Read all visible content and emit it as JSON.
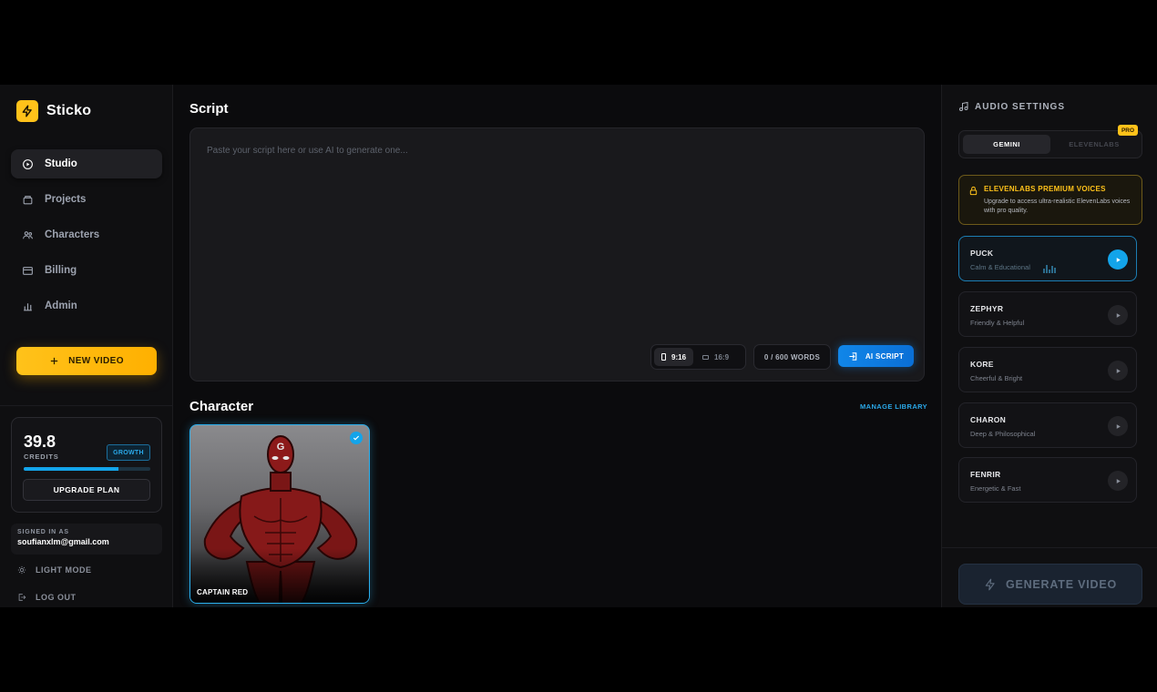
{
  "brand": {
    "name": "Sticko"
  },
  "nav": [
    {
      "label": "Studio",
      "icon": "play-circle-icon",
      "active": true
    },
    {
      "label": "Projects",
      "icon": "folder-icon",
      "active": false
    },
    {
      "label": "Characters",
      "icon": "users-icon",
      "active": false
    },
    {
      "label": "Billing",
      "icon": "credit-card-icon",
      "active": false
    },
    {
      "label": "Admin",
      "icon": "bar-chart-icon",
      "active": false
    }
  ],
  "new_video": {
    "label": "NEW VIDEO"
  },
  "credits": {
    "amount": "39.8",
    "label": "CREDITS",
    "plan": "GROWTH",
    "usage_fraction": 0.75,
    "upgrade_label": "UPGRADE PLAN"
  },
  "account": {
    "signed_in_label": "SIGNED IN AS",
    "email": "soufianxlm@gmail.com",
    "light_mode_label": "LIGHT MODE",
    "logout_label": "LOG OUT"
  },
  "script": {
    "title": "Script",
    "placeholder": "Paste your script here or use AI to generate one...",
    "ratios": [
      {
        "label": "9:16",
        "active": true
      },
      {
        "label": "16:9",
        "active": false
      }
    ],
    "word_count": "0 / 600 WORDS",
    "ai_label": "AI SCRIPT"
  },
  "character": {
    "title": "Character",
    "manage_label": "MANAGE LIBRARY",
    "selected": {
      "name": "CAPTAIN RED",
      "emblem": "G"
    }
  },
  "audio": {
    "title": "AUDIO SETTINGS",
    "providers": [
      {
        "label": "GEMINI",
        "active": true
      },
      {
        "label": "ELEVENLABS",
        "active": false
      }
    ],
    "pro_badge": "PRO",
    "premium": {
      "title": "ELEVENLABS PREMIUM VOICES",
      "desc": "Upgrade to access ultra-realistic ElevenLabs voices with pro quality."
    },
    "voices": [
      {
        "name": "PUCK",
        "desc": "Calm & Educational",
        "active": true
      },
      {
        "name": "ZEPHYR",
        "desc": "Friendly & Helpful",
        "active": false
      },
      {
        "name": "KORE",
        "desc": "Cheerful & Bright",
        "active": false
      },
      {
        "name": "CHARON",
        "desc": "Deep & Philosophical",
        "active": false
      },
      {
        "name": "FENRIR",
        "desc": "Energetic & Fast",
        "active": false
      }
    ],
    "generate_label": "GENERATE VIDEO"
  },
  "colors": {
    "accent_yellow": "#ffc21a",
    "accent_blue": "#13a4ea",
    "background": "#0b0b0d"
  }
}
